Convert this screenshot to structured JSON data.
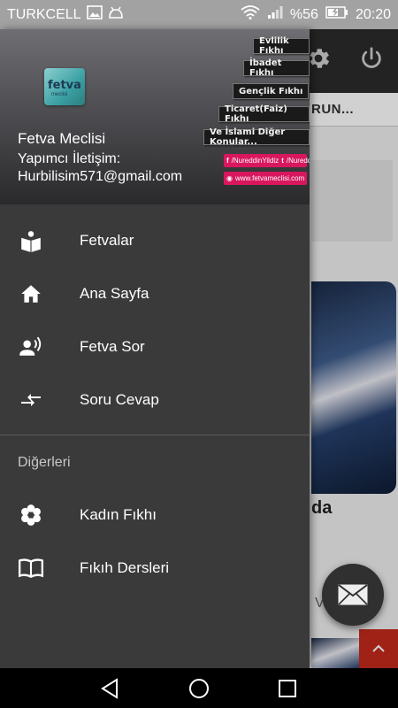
{
  "status_bar": {
    "carrier": "TURKCELL",
    "battery_percent": "%56",
    "time": "20:20"
  },
  "background_app": {
    "tab_text": "RUN...",
    "visible_word": "da",
    "partial_text": "V...?"
  },
  "drawer": {
    "header": {
      "title": "Fetva Meclisi",
      "contact_label": "Yapımcı İletişim:",
      "email": "Hurbilisim571@gmail.com",
      "logo_text": "fetva",
      "logo_sub": "meclisi",
      "tags": [
        "Evlilik Fıkhı",
        "İbadet Fıkhı",
        "Gençlik Fıkhı",
        "Ticaret(Faiz) Fıkhı",
        "Ve İslami Diğer Konular..."
      ],
      "social_facebook": "/NureddinYildiz",
      "social_twitter": "/NureddinYildiz",
      "website": "www.fetvameclisi.com"
    },
    "items": [
      {
        "label": "Fetvalar",
        "icon": "reader-icon"
      },
      {
        "label": "Ana Sayfa",
        "icon": "home-icon"
      },
      {
        "label": "Fetva Sor",
        "icon": "voice-person-icon"
      },
      {
        "label": "Soru Cevap",
        "icon": "compare-arrows-icon"
      }
    ],
    "section_title": "Diğerleri",
    "other_items": [
      {
        "label": "Kadın Fıkhı",
        "icon": "flower-icon"
      },
      {
        "label": "Fıkıh Dersleri",
        "icon": "book-icon"
      }
    ]
  },
  "colors": {
    "drawer_bg": "#3a3a3a",
    "status_bar": "#a2a2a2",
    "accent_red": "#c42a1c",
    "social_pink": "#d8175e"
  }
}
